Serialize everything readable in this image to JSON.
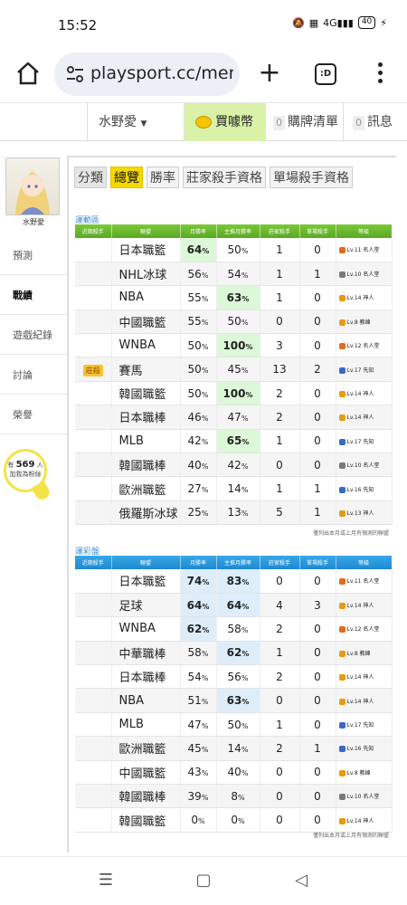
{
  "status_bar": {
    "time": "15:52",
    "network": "4G",
    "battery": "40"
  },
  "browser": {
    "url": "playsport.cc/men",
    "tabs_label": ":D"
  },
  "site_nav": {
    "user": "水野愛",
    "buy_label": "買噱幣",
    "cart_count": "0",
    "cart_label": "購牌清單",
    "msg_count": "0",
    "msg_label": "訊息"
  },
  "sidebar": {
    "avatar_name": "水野愛",
    "items": [
      "預測",
      "戰績",
      "遊戲紀錄",
      "討論",
      "榮譽"
    ],
    "active_item": "戰績",
    "fans_prefix": "有",
    "fans_count": "569",
    "fans_suffix": "人",
    "fans_line2": "加我為粉絲"
  },
  "tabs": [
    "分類",
    "總覽",
    "勝率",
    "莊家殺手資格",
    "單場殺手資格"
  ],
  "active_tab": "總覽",
  "table_headers": [
    "近期殺手",
    "聯盟",
    "月勝率",
    "主推月勝率",
    "莊家殺手",
    "單場殺手",
    "等級"
  ],
  "colors": {
    "green_header": "#5aa823",
    "blue_header": "#1e88d0",
    "active_tab": "#f5d800",
    "highlight_green": "#ddf8d8",
    "highlight_blue": "#ddeefa"
  },
  "section_green": {
    "title": "運動區",
    "footnote": "僅列出本月或上月有預測的聯盟",
    "rows": [
      {
        "killer": "",
        "league": "日本職籃",
        "month": "64",
        "main": "50",
        "bank": "1",
        "single": "0",
        "level": "Lv.11 名人堂",
        "lvcolor": "#e46a1a",
        "hl": "month"
      },
      {
        "killer": "",
        "league": "NHL冰球",
        "month": "56",
        "main": "54",
        "bank": "1",
        "single": "1",
        "level": "Lv.10 名人堂",
        "lvcolor": "#7a7a7a",
        "hl": ""
      },
      {
        "killer": "",
        "league": "NBA",
        "month": "55",
        "main": "63",
        "bank": "1",
        "single": "0",
        "level": "Lv.14 神人",
        "lvcolor": "#e89a10",
        "hl": "main"
      },
      {
        "killer": "",
        "league": "中國職籃",
        "month": "55",
        "main": "50",
        "bank": "0",
        "single": "0",
        "level": "Lv.8 教練",
        "lvcolor": "#e89a10",
        "hl": ""
      },
      {
        "killer": "",
        "league": "WNBA",
        "month": "50",
        "main": "100",
        "bank": "3",
        "single": "0",
        "level": "Lv.12 名人堂",
        "lvcolor": "#e46a1a",
        "hl": "main"
      },
      {
        "killer": "莊殺",
        "league": "賽馬",
        "month": "50",
        "main": "45",
        "bank": "13",
        "single": "2",
        "level": "Lv.17 先知",
        "lvcolor": "#3a68c8",
        "hl": ""
      },
      {
        "killer": "",
        "league": "韓國職籃",
        "month": "50",
        "main": "100",
        "bank": "2",
        "single": "0",
        "level": "Lv.14 神人",
        "lvcolor": "#e89a10",
        "hl": "main"
      },
      {
        "killer": "",
        "league": "日本職棒",
        "month": "46",
        "main": "47",
        "bank": "2",
        "single": "0",
        "level": "Lv.14 神人",
        "lvcolor": "#e89a10",
        "hl": ""
      },
      {
        "killer": "",
        "league": "MLB",
        "month": "42",
        "main": "65",
        "bank": "1",
        "single": "0",
        "level": "Lv.17 先知",
        "lvcolor": "#3a68c8",
        "hl": "main"
      },
      {
        "killer": "",
        "league": "韓國職棒",
        "month": "40",
        "main": "42",
        "bank": "0",
        "single": "0",
        "level": "Lv.10 名人堂",
        "lvcolor": "#7a7a7a",
        "hl": ""
      },
      {
        "killer": "",
        "league": "歐洲職籃",
        "month": "27",
        "main": "14",
        "bank": "1",
        "single": "1",
        "level": "Lv.16 先知",
        "lvcolor": "#3a68c8",
        "hl": ""
      },
      {
        "killer": "",
        "league": "俄羅斯冰球",
        "month": "25",
        "main": "13",
        "bank": "5",
        "single": "1",
        "level": "Lv.13 神人",
        "lvcolor": "#e89a10",
        "hl": ""
      }
    ]
  },
  "section_blue": {
    "title": "運彩盤",
    "footnote": "僅列出本月或上月有預測的聯盟",
    "rows": [
      {
        "killer": "",
        "league": "日本職籃",
        "month": "74",
        "main": "83",
        "bank": "0",
        "single": "0",
        "level": "Lv.11 名人堂",
        "lvcolor": "#e46a1a",
        "hl": "both"
      },
      {
        "killer": "",
        "league": "足球",
        "month": "64",
        "main": "64",
        "bank": "4",
        "single": "3",
        "level": "Lv.14 神人",
        "lvcolor": "#e89a10",
        "hl": "both"
      },
      {
        "killer": "",
        "league": "WNBA",
        "month": "62",
        "main": "58",
        "bank": "2",
        "single": "0",
        "level": "Lv.12 名人堂",
        "lvcolor": "#e46a1a",
        "hl": "month"
      },
      {
        "killer": "",
        "league": "中華職棒",
        "month": "58",
        "main": "62",
        "bank": "1",
        "single": "0",
        "level": "Lv.8 教練",
        "lvcolor": "#e89a10",
        "hl": "main"
      },
      {
        "killer": "",
        "league": "日本職棒",
        "month": "54",
        "main": "56",
        "bank": "2",
        "single": "0",
        "level": "Lv.14 神人",
        "lvcolor": "#e89a10",
        "hl": ""
      },
      {
        "killer": "",
        "league": "NBA",
        "month": "51",
        "main": "63",
        "bank": "0",
        "single": "0",
        "level": "Lv.14 神人",
        "lvcolor": "#e89a10",
        "hl": "main"
      },
      {
        "killer": "",
        "league": "MLB",
        "month": "47",
        "main": "50",
        "bank": "1",
        "single": "0",
        "level": "Lv.17 先知",
        "lvcolor": "#3a68c8",
        "hl": ""
      },
      {
        "killer": "",
        "league": "歐洲職籃",
        "month": "45",
        "main": "14",
        "bank": "2",
        "single": "1",
        "level": "Lv.16 先知",
        "lvcolor": "#3a68c8",
        "hl": ""
      },
      {
        "killer": "",
        "league": "中國職籃",
        "month": "43",
        "main": "40",
        "bank": "0",
        "single": "0",
        "level": "Lv.8 教練",
        "lvcolor": "#e89a10",
        "hl": ""
      },
      {
        "killer": "",
        "league": "韓國職棒",
        "month": "39",
        "main": "8",
        "bank": "0",
        "single": "0",
        "level": "Lv.10 名人堂",
        "lvcolor": "#7a7a7a",
        "hl": ""
      },
      {
        "killer": "",
        "league": "韓國職籃",
        "month": "0",
        "main": "0",
        "bank": "0",
        "single": "0",
        "level": "Lv.14 神人",
        "lvcolor": "#e89a10",
        "hl": ""
      }
    ]
  },
  "pct_unit": "%"
}
